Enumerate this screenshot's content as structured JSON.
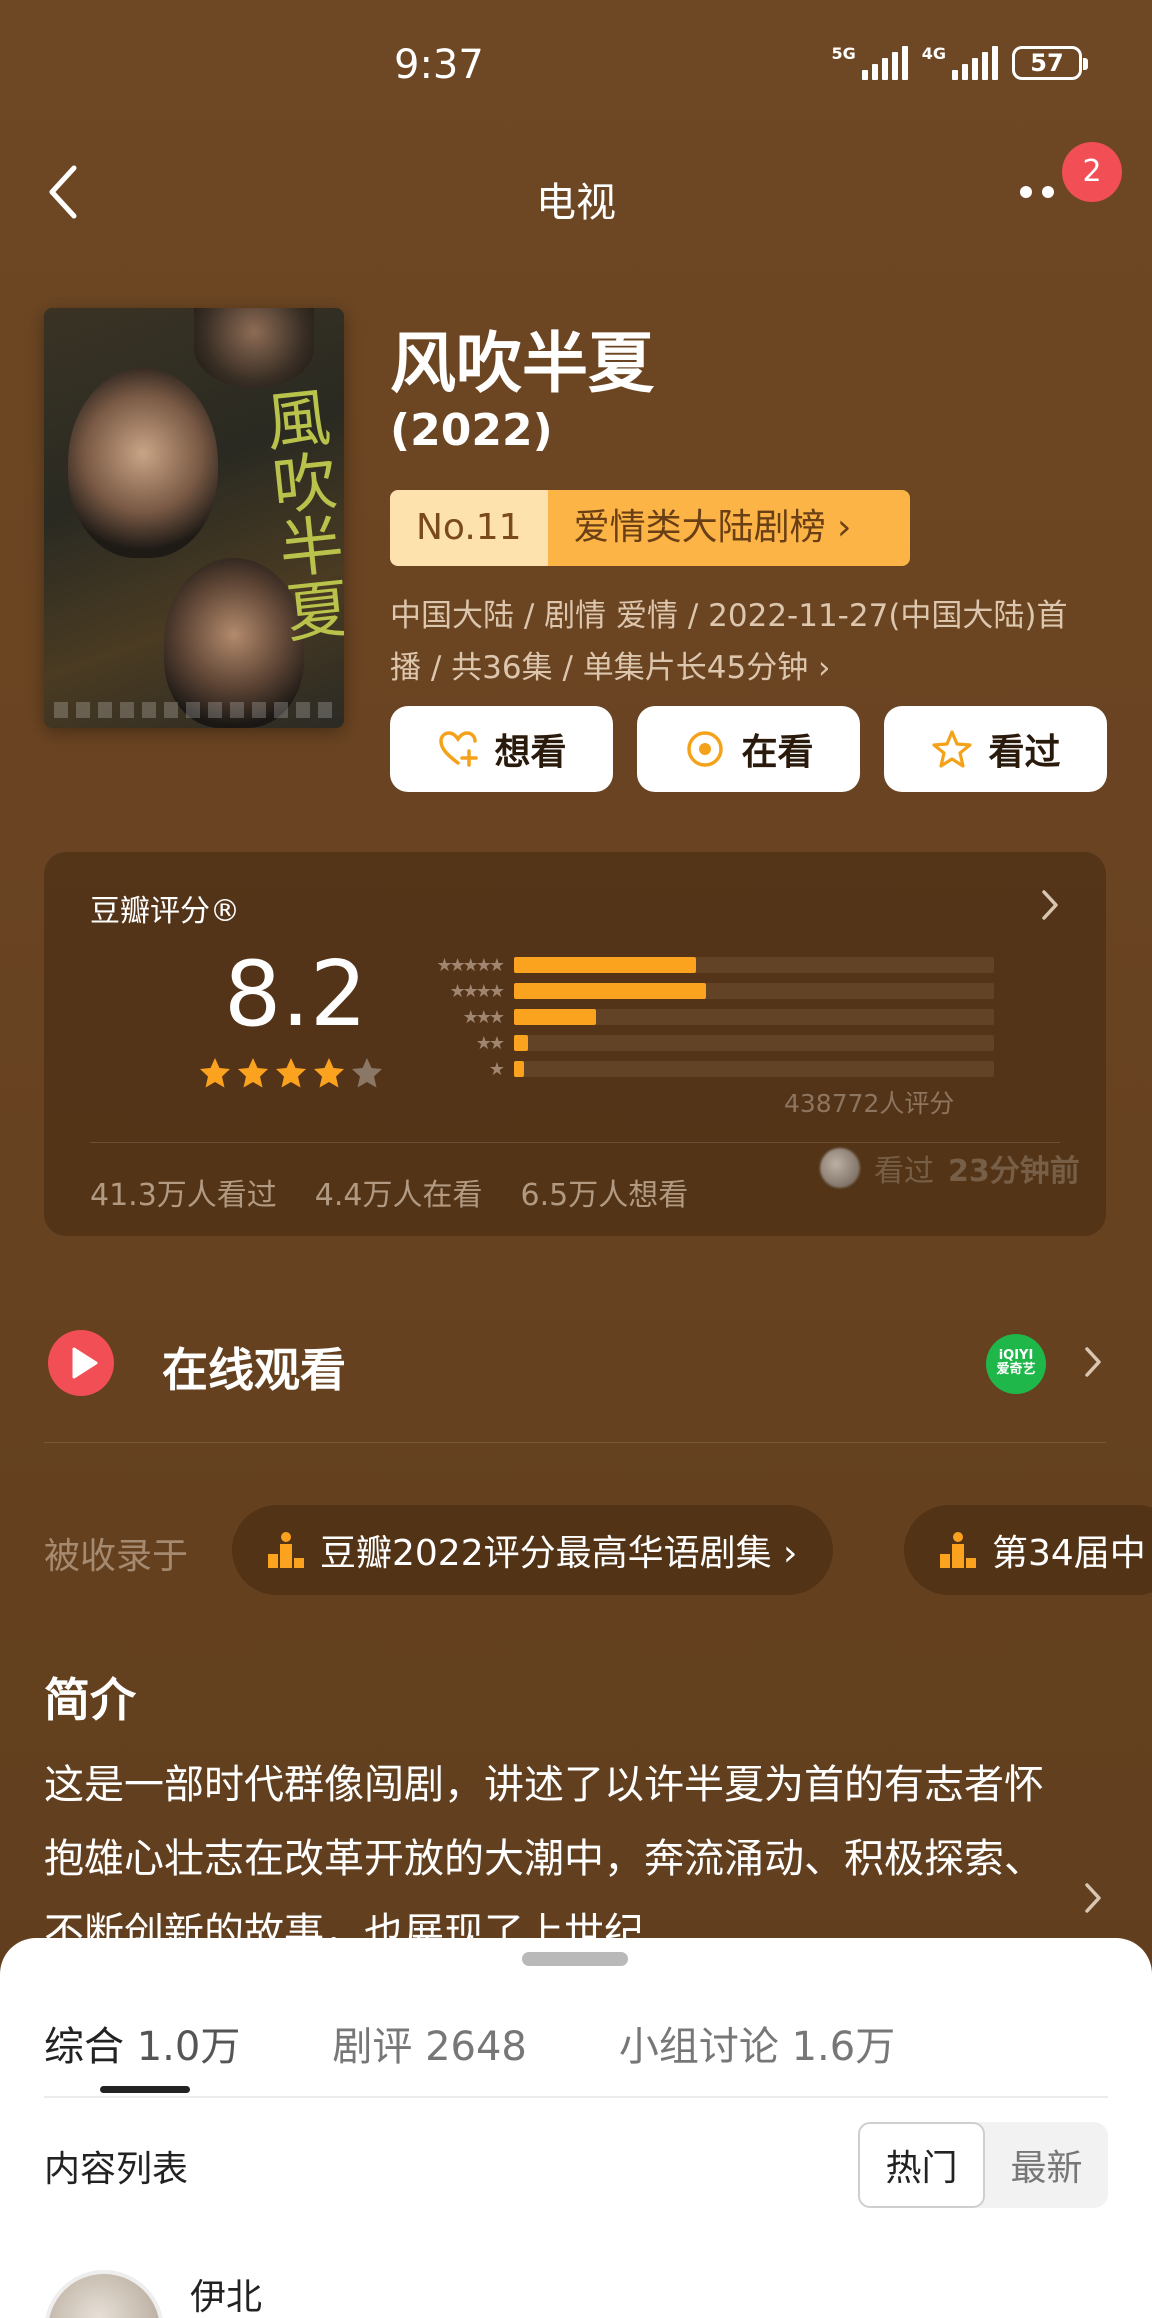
{
  "status_bar": {
    "time": "9:37",
    "net1": "5G",
    "net2": "4G",
    "battery": "57"
  },
  "nav": {
    "title": "电视",
    "badge_count": "2"
  },
  "movie": {
    "title": "风吹半夏",
    "year": "(2022)",
    "poster_calligraphy": "風吹半夏",
    "rank_no": "No.11",
    "rank_name": "爱情类大陆剧榜 ›",
    "meta_line1": "中国大陆 / 剧情 爱情 / 2022-11-27(中国大陆)首",
    "meta_line2": "播 / 共36集 / 单集片长45分钟 ›"
  },
  "actions": {
    "want": "想看",
    "watching": "在看",
    "watched": "看过"
  },
  "rating": {
    "title": "豆瓣评分®",
    "score": "8.2",
    "stars": 4,
    "distribution": [
      {
        "stars": "★★★★★",
        "percent": 38
      },
      {
        "stars": "★★★★",
        "percent": 40
      },
      {
        "stars": "★★★",
        "percent": 17
      },
      {
        "stars": "★★",
        "percent": 3
      },
      {
        "stars": "★",
        "percent": 2
      }
    ],
    "votes": "438772人评分",
    "stat_watched": "41.3万人看过",
    "stat_watching": "4.4万人在看",
    "stat_want": "6.5万人想看",
    "recent_action": "看过",
    "recent_time": "23分钟前"
  },
  "online": {
    "label": "在线观看",
    "platform_line1": "iQIYI",
    "platform_line2": "爱奇艺"
  },
  "collected": {
    "label": "被收录于",
    "chips": [
      "豆瓣2022评分最高华语剧集 ›",
      "第34届中"
    ]
  },
  "intro": {
    "title": "简介",
    "text": "这是一部时代群像闯剧，讲述了以许半夏为首的有志者怀抱雄心壮志在改革开放的大潮中，奔流涌动、积极探索、不断创新的故事，也展现了上世纪"
  },
  "sheet": {
    "tabs": [
      {
        "label": "综合",
        "count": "1.0万"
      },
      {
        "label": "剧评",
        "count": "2648"
      },
      {
        "label": "小组讨论",
        "count": "1.6万"
      }
    ],
    "list_label": "内容列表",
    "sort_hot": "热门",
    "sort_new": "最新",
    "first_user": "伊北"
  },
  "colors": {
    "accent_orange": "#fba31f",
    "badge_red": "#f24e55",
    "play_red": "#f24e55"
  }
}
